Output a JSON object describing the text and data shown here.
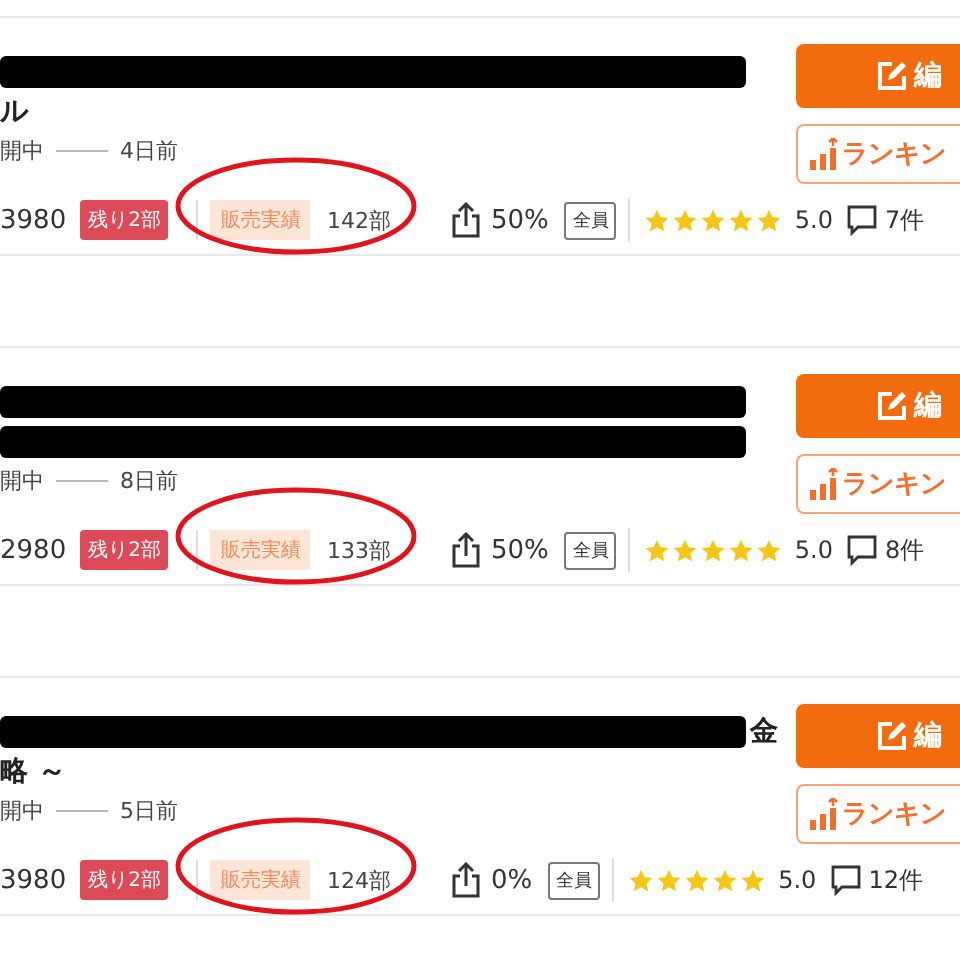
{
  "listings": [
    {
      "title_lines": [
        {
          "kind": "redacted"
        },
        {
          "kind": "text",
          "text": "ル"
        }
      ],
      "status": "開中",
      "posted": "4日前",
      "price": "3980",
      "remaining": "残り2部",
      "sales_label": "販売実績",
      "sales_count": "142部",
      "sales_highlighted": true,
      "share": "50%",
      "audience": "全員",
      "stars": 5,
      "rating": "5.0",
      "comments": "7件",
      "edit_button": "編",
      "ranking_button": "ランキン"
    },
    {
      "title_lines": [
        {
          "kind": "redacted"
        },
        {
          "kind": "redacted"
        }
      ],
      "status": "開中",
      "posted": "8日前",
      "price": "2980",
      "remaining": "残り2部",
      "sales_label": "販売実績",
      "sales_count": "133部",
      "sales_highlighted": true,
      "share": "50%",
      "audience": "全員",
      "stars": 5,
      "rating": "5.0",
      "comments": "8件",
      "edit_button": "編",
      "ranking_button": "ランキン"
    },
    {
      "title_lines": [
        {
          "kind": "redacted",
          "trailing_text": "金"
        },
        {
          "kind": "text",
          "text": "略 ～"
        }
      ],
      "status": "開中",
      "posted": "5日前",
      "price": "3980",
      "remaining": "残り2部",
      "sales_label": "販売実績",
      "sales_count": "124部",
      "sales_highlighted": true,
      "share": "0%",
      "audience": "全員",
      "stars": 5,
      "rating": "5.0",
      "comments": "12件",
      "edit_button": "編",
      "ranking_button": "ランキン"
    }
  ]
}
